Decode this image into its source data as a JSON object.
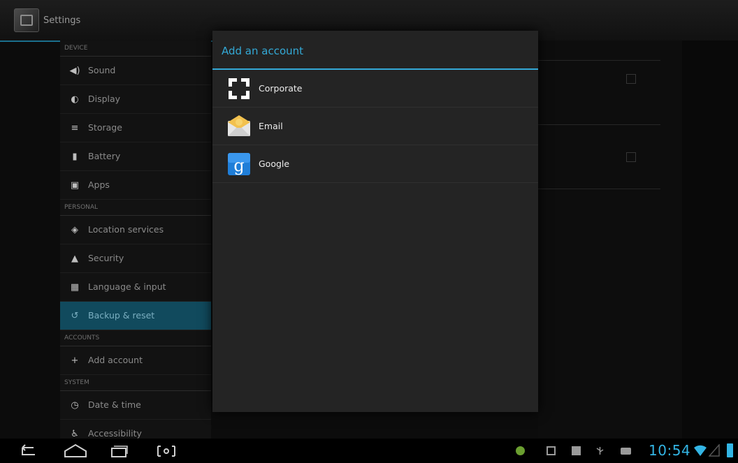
{
  "app": {
    "title": "Settings"
  },
  "sidebar": {
    "sections": [
      {
        "header": "DEVICE"
      },
      {
        "header": "PERSONAL"
      },
      {
        "header": "ACCOUNTS"
      },
      {
        "header": "SYSTEM"
      }
    ],
    "items": {
      "sound": "Sound",
      "display": "Display",
      "storage": "Storage",
      "battery": "Battery",
      "apps": "Apps",
      "location": "Location services",
      "security": "Security",
      "language": "Language & input",
      "backup": "Backup & reset",
      "add_account": "Add account",
      "date_time": "Date & time",
      "accessibility": "Accessibility"
    },
    "selected_item": "Backup & reset"
  },
  "dialog": {
    "title": "Add an account",
    "accounts": [
      {
        "label": "Corporate",
        "icon": "corporate-icon"
      },
      {
        "label": "Email",
        "icon": "email-icon"
      },
      {
        "label": "Google",
        "icon": "google-icon"
      }
    ]
  },
  "status_bar": {
    "time": "10:54"
  },
  "colors": {
    "accent": "#33b5e5",
    "dialog_title": "#33a9d6",
    "selected_bg": "#114a5d"
  }
}
